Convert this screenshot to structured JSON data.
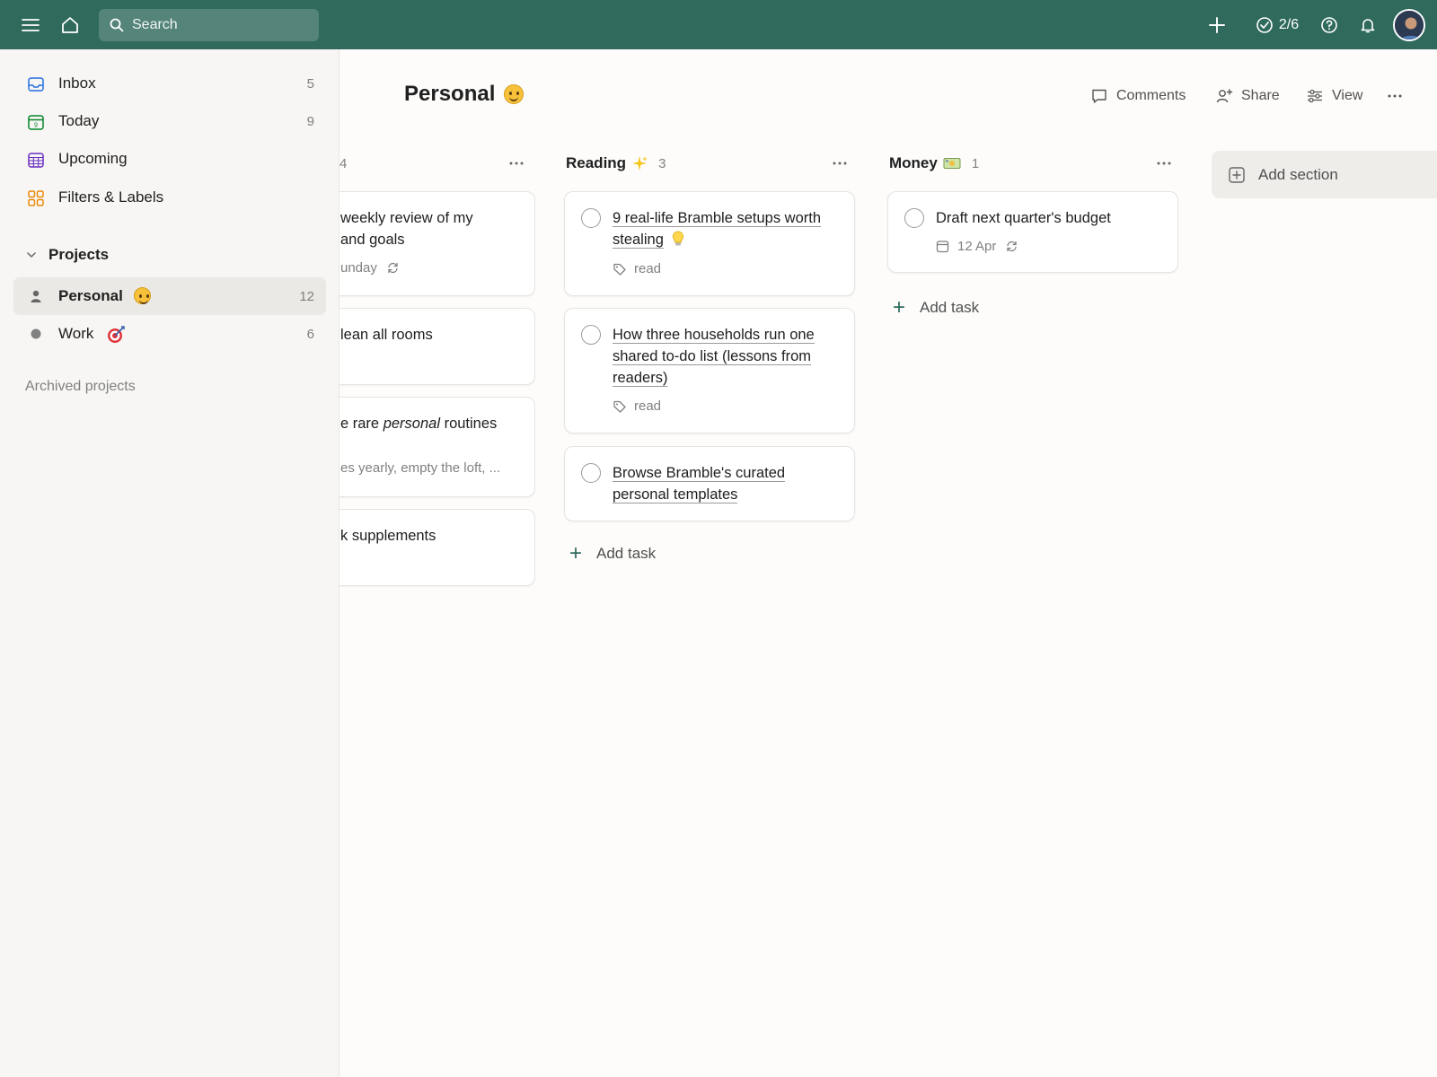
{
  "topbar": {
    "search_placeholder": "Search",
    "karma": "2/6",
    "accent_color": "#2f6a5d",
    "icons": [
      "menu-icon",
      "home-icon",
      "search-icon",
      "plus-icon",
      "check-circle-icon",
      "help-icon",
      "bell-icon"
    ]
  },
  "sidebar": {
    "nav": [
      {
        "label": "Inbox",
        "count": "5",
        "icon": "inbox-icon"
      },
      {
        "label": "Today",
        "count": "9",
        "icon": "today-icon"
      },
      {
        "label": "Upcoming",
        "icon": "upcoming-icon"
      },
      {
        "label": "Filters & Labels",
        "icon": "filters-labels-icon"
      }
    ],
    "projects_header": "Projects",
    "projects": [
      {
        "label": "Personal",
        "count": "12",
        "emoji": "smiley",
        "active": true
      },
      {
        "label": "Work",
        "count": "6",
        "emoji": "target"
      }
    ],
    "archived_label": "Archived projects"
  },
  "page": {
    "title": "Personal",
    "actions": {
      "comments": "Comments",
      "share": "Share",
      "view": "View"
    }
  },
  "board": {
    "first_section_count_fragment": "4",
    "first_section_cards": [
      {
        "title_line1": "weekly review of my",
        "title_line2": "and goals",
        "meta": "unday"
      },
      {
        "title": "lean all rooms"
      },
      {
        "title_prefix": "e rare ",
        "title_italic": "personal",
        "title_suffix": " routines",
        "description": "es yearly, empty the loft, ..."
      },
      {
        "title": "k supplements"
      }
    ],
    "sections": [
      {
        "name": "Reading",
        "emoji": "sparkles",
        "count": "3",
        "cards": [
          {
            "title": "9 real-life Bramble setups worth stealing",
            "emoji": "bulb",
            "label": "read"
          },
          {
            "title": "How three households run one shared to-do list (lessons from readers)",
            "label": "read"
          },
          {
            "title": "Browse Bramble's curated personal templates"
          }
        ],
        "add_task": "Add task"
      },
      {
        "name": "Money",
        "emoji": "money",
        "count": "1",
        "cards": [
          {
            "title": "Draft next quarter's budget",
            "date": "12 Apr"
          }
        ],
        "add_task": "Add task"
      }
    ],
    "add_section": "Add section"
  }
}
